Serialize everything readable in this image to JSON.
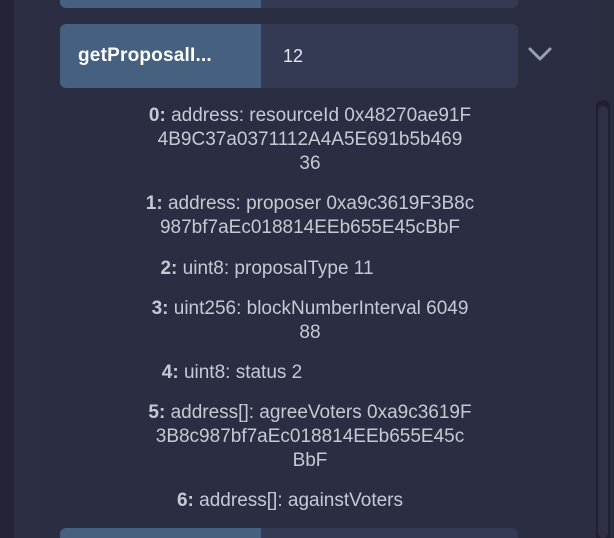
{
  "function_call": {
    "button_label": "getProposalI...",
    "input_value": "12"
  },
  "results": [
    {
      "index": "0:",
      "lines": [
        "address: resourceId 0x48270ae91F",
        "4B9C37a0371112A4A5E691b5b469",
        "36"
      ]
    },
    {
      "index": "1:",
      "lines": [
        "address: proposer 0xa9c3619F3B8c",
        "987bf7aEc018814EEb655E45cBbF"
      ]
    },
    {
      "index": "2:",
      "lines": [
        "uint8: proposalType 11"
      ]
    },
    {
      "index": "3:",
      "lines": [
        "uint256: blockNumberInterval 6049",
        "88"
      ]
    },
    {
      "index": "4:",
      "lines": [
        "uint8: status 2"
      ]
    },
    {
      "index": "5:",
      "lines": [
        "address[]: agreeVoters 0xa9c3619F",
        "3B8c987bf7aEc018814EEb655E45c",
        "BbF"
      ]
    },
    {
      "index": "6:",
      "lines": [
        "address[]: againstVoters"
      ]
    }
  ],
  "icons": {
    "expand": "chevron-down-icon"
  },
  "colors": {
    "background": "#2a2c3f",
    "button": "#45617f",
    "input": "#353a54",
    "text": "#c5c9d6"
  }
}
